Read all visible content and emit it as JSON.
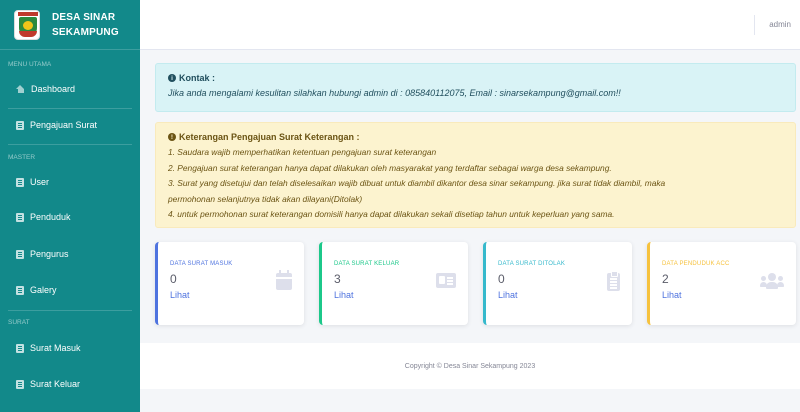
{
  "brand": {
    "line1": "DESA SINAR",
    "line2": "SEKAMPUNG"
  },
  "topbar": {
    "user": "admin"
  },
  "sidebar": {
    "sections": {
      "main": "MENU UTAMA",
      "master": "MASTER",
      "surat": "SURAT"
    },
    "items": [
      {
        "label": "Dashboard",
        "icon": "home-icon"
      },
      {
        "label": "Pengajuan Surat",
        "icon": "document-icon"
      },
      {
        "label": "User",
        "icon": "document-icon"
      },
      {
        "label": "Penduduk",
        "icon": "document-icon"
      },
      {
        "label": "Pengurus",
        "icon": "document-icon"
      },
      {
        "label": "Galery",
        "icon": "document-icon"
      },
      {
        "label": "Surat Masuk",
        "icon": "document-icon"
      },
      {
        "label": "Surat Keluar",
        "icon": "document-icon"
      }
    ]
  },
  "contact_alert": {
    "title": "Kontak :",
    "body": "Jika anda mengalami kesulitan silahkan hubungi admin di : 085840112075, Email : sinarsekampung@gmail.com!!"
  },
  "info_alert": {
    "title": "Keterangan Pengajuan Surat Keterangan :",
    "lines": [
      "1. Saudara wajib memperhatikan ketentuan pengajuan surat keterangan",
      "2. Pengajuan surat keterangan hanya dapat dilakukan oleh masyarakat yang terdaftar sebagai warga desa sekampung.",
      "3. Surat yang disetujui dan telah diselesaikan wajib dibuat untuk diambil dikantor desa sinar sekampung. jika surat tidak diambil, maka",
      "permohonan selanjutnya tidak akan dilayani(Ditolak)",
      "4. untuk permohonan surat keterangan domisili hanya dapat dilakukan sekali disetiap tahun untuk keperluan yang sama."
    ]
  },
  "cards": [
    {
      "title": "DATA SURAT MASUK",
      "value": "0",
      "link": "Lihat",
      "accent": "#4e73df",
      "icon": "calendar-icon"
    },
    {
      "title": "DATA SURAT KELUAR",
      "value": "3",
      "link": "Lihat",
      "accent": "#1cc88a",
      "icon": "id-card-icon"
    },
    {
      "title": "DATA SURAT DITOLAK",
      "value": "0",
      "link": "Lihat",
      "accent": "#36b9cc",
      "icon": "clipboard-icon"
    },
    {
      "title": "DATA PENDUDUK ACC",
      "value": "2",
      "link": "Lihat",
      "accent": "#f6c23e",
      "icon": "users-icon"
    }
  ],
  "footer": {
    "text": "Copyright © Desa Sinar Sekampung 2023"
  },
  "colors": {
    "sidebar": "#12898a",
    "info_bg": "#d9f3f6",
    "warning_bg": "#fcf3cf"
  }
}
